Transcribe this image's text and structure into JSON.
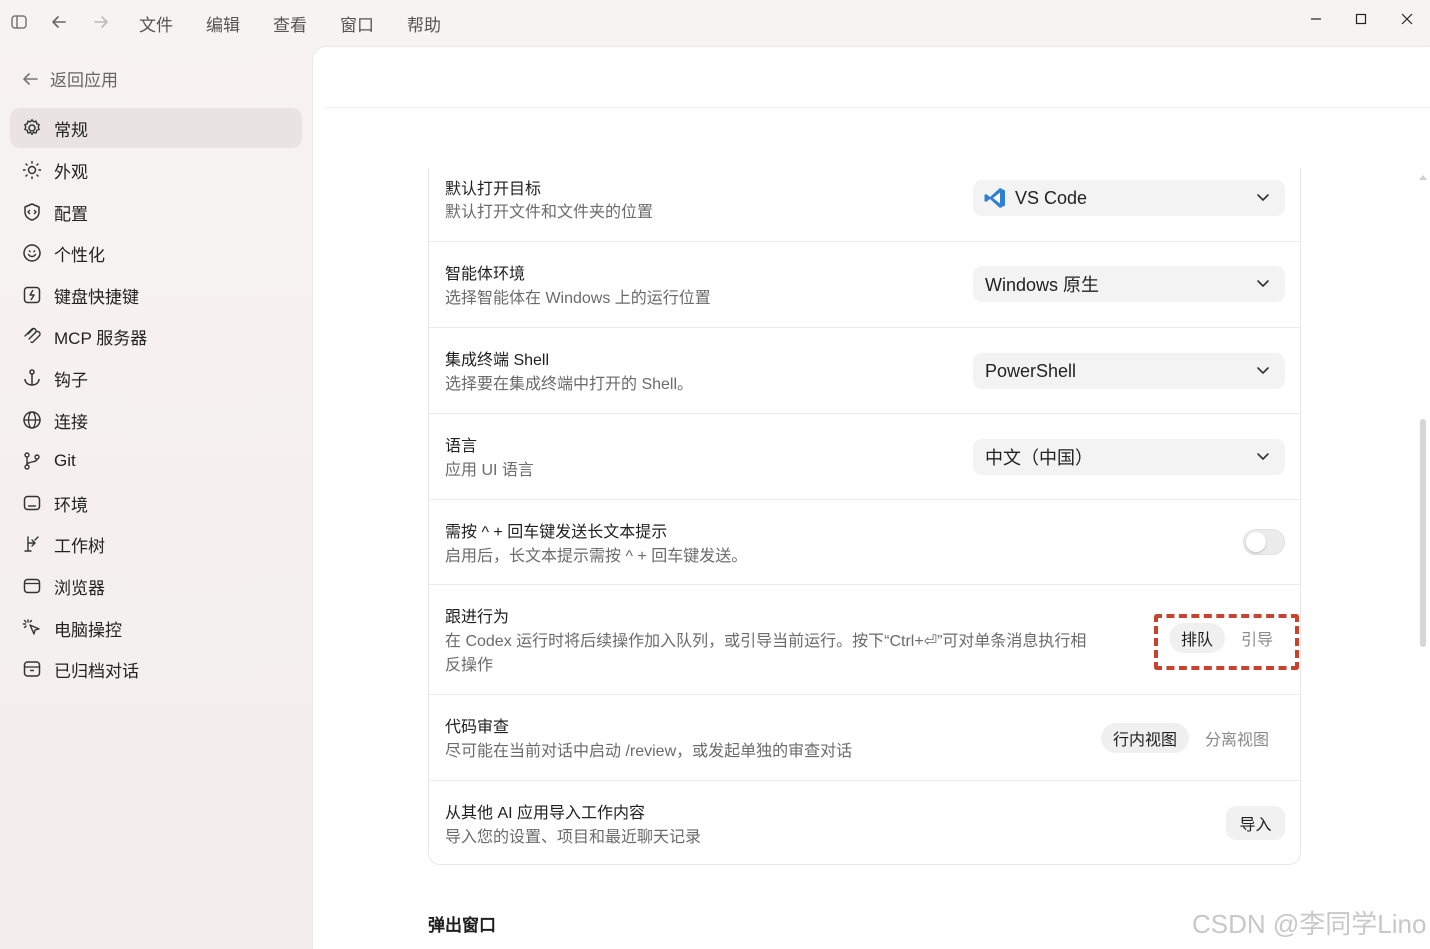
{
  "titlebar": {
    "menus": [
      "文件",
      "编辑",
      "查看",
      "窗口",
      "帮助"
    ]
  },
  "sidebar": {
    "back_label": "返回应用",
    "items": [
      {
        "label": "常规",
        "icon": "gear-icon",
        "active": true
      },
      {
        "label": "外观",
        "icon": "sun-icon",
        "active": false
      },
      {
        "label": "配置",
        "icon": "config-icon",
        "active": false
      },
      {
        "label": "个性化",
        "icon": "smile-icon",
        "active": false
      },
      {
        "label": "键盘快捷键",
        "icon": "keyboard-bolt-icon",
        "active": false
      },
      {
        "label": "MCP 服务器",
        "icon": "mcp-icon",
        "active": false
      },
      {
        "label": "钩子",
        "icon": "anchor-icon",
        "active": false
      },
      {
        "label": "连接",
        "icon": "globe-icon",
        "active": false
      },
      {
        "label": "Git",
        "icon": "git-branch-icon",
        "active": false
      },
      {
        "label": "环境",
        "icon": "environment-icon",
        "active": false
      },
      {
        "label": "工作树",
        "icon": "worktree-icon",
        "active": false
      },
      {
        "label": "浏览器",
        "icon": "browser-icon",
        "active": false
      },
      {
        "label": "电脑操控",
        "icon": "computer-control-icon",
        "active": false
      },
      {
        "label": "已归档对话",
        "icon": "archive-icon",
        "active": false
      }
    ]
  },
  "settings": {
    "default_open": {
      "title": "默认打开目标",
      "desc": "默认打开文件和文件夹的位置",
      "value": "VS Code"
    },
    "agent_env": {
      "title": "智能体环境",
      "desc": "选择智能体在 Windows 上的运行位置",
      "value": "Windows 原生"
    },
    "shell": {
      "title": "集成终端 Shell",
      "desc": "选择要在集成终端中打开的 Shell。",
      "value": "PowerShell"
    },
    "language": {
      "title": "语言",
      "desc": "应用 UI 语言",
      "value": "中文（中国）"
    },
    "long_prompt": {
      "title": "需按 ^ + 回车键发送长文本提示",
      "desc": "启用后，长文本提示需按 ^ + 回车键发送。",
      "enabled": false
    },
    "follow_up": {
      "title": "跟进行为",
      "desc_line1": "在 Codex 运行时将后续操作加入队列，或引导当前运行。按下“Ctrl+⏎”可对单条消息执行相",
      "desc_line2": "反操作",
      "options": [
        "排队",
        "引导"
      ],
      "selected": "排队"
    },
    "code_review": {
      "title": "代码审查",
      "desc": "尽可能在当前对话中启动 /review，或发起单独的审查对话",
      "options": [
        "行内视图",
        "分离视图"
      ],
      "selected": "行内视图"
    },
    "import": {
      "title": "从其他 AI 应用导入工作内容",
      "desc": "导入您的设置、项目和最近聊天记录",
      "button": "导入"
    }
  },
  "next_section_title": "弹出窗口",
  "watermark": "CSDN @李同学Lino",
  "colors": {
    "highlight": "#c8432e",
    "vscode_blue": "#2f7fd6"
  }
}
